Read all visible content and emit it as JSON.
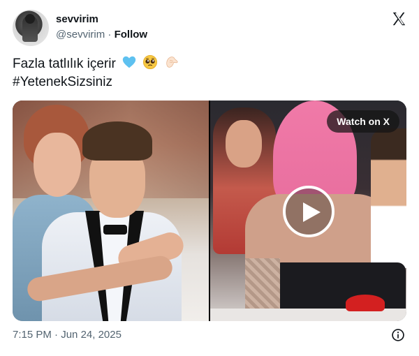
{
  "author": {
    "display_name": "sevvirim",
    "handle": "@sevvirim",
    "separator": "·",
    "follow_label": "Follow"
  },
  "tweet": {
    "text_line1": "Fazla tatlılık içerir",
    "text_line2": "#YetenekSizsiniz",
    "emojis": [
      "blue-heart-emoji",
      "pleading-face-emoji",
      "pinched-fingers-emoji"
    ]
  },
  "media": {
    "watch_label": "Watch on X",
    "play_icon": "play-icon"
  },
  "footer": {
    "time": "7:15 PM",
    "separator": "·",
    "date": "Jun 24, 2025"
  },
  "colors": {
    "text": "#0f1419",
    "muted": "#536471",
    "heart": "#5ec1f0"
  }
}
